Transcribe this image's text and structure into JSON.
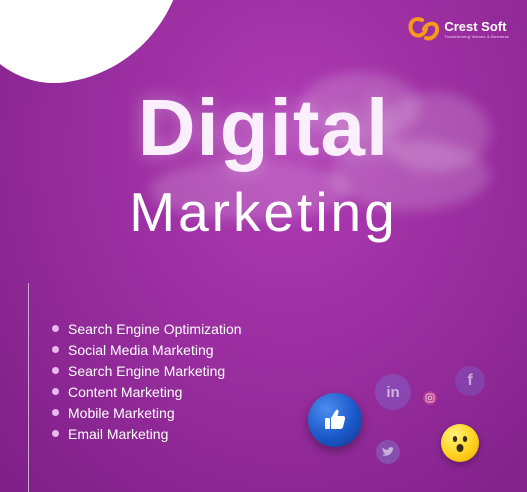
{
  "logo": {
    "name": "Crest Soft",
    "tagline": "Transforming Visions & Business",
    "icon": "crest-swoosh-logo"
  },
  "title": {
    "line1": "Digital",
    "line2": "Marketing"
  },
  "services": [
    "Search Engine Optimization",
    "Social Media Marketing",
    "Search Engine Marketing",
    "Content Marketing",
    "Mobile Marketing",
    "Email Marketing"
  ],
  "social_icons": {
    "linkedin": "in",
    "facebook": "f",
    "like": "thumbs-up-icon",
    "emoji": "surprised-emoji-icon",
    "instagram": "instagram-icon",
    "twitter": "twitter-bird-icon"
  },
  "colors": {
    "background": "#9a2ea0",
    "accent_orange": "#f59a1b",
    "bullet": "#e8b9ee"
  }
}
